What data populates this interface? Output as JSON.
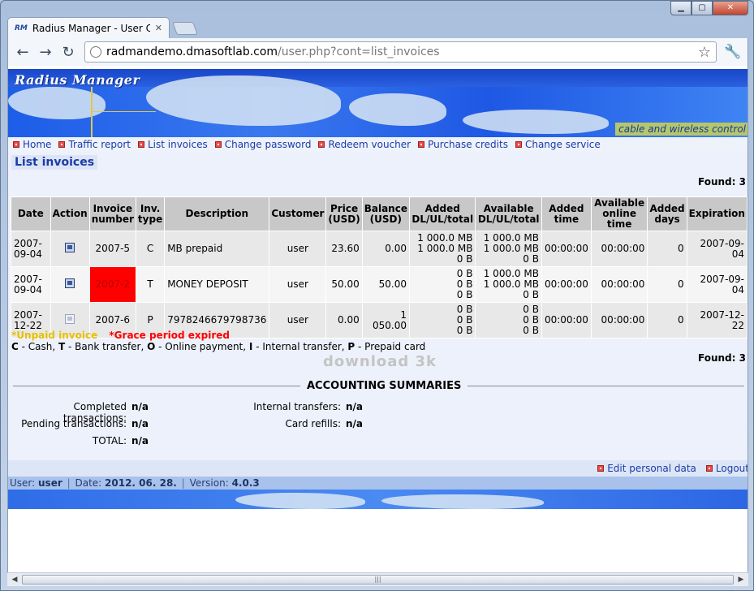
{
  "browser": {
    "tab_title": "Radius Manager - User Con",
    "tab_favicon": "RM",
    "url_host": "radmandemo.dmasoftlab.com",
    "url_path": "/user.php?cont=list_invoices",
    "close_glyph": "✕",
    "min_glyph": "▁",
    "max_glyph": "▢",
    "back_glyph": "←",
    "forward_glyph": "→",
    "reload_glyph": "↻",
    "star_glyph": "☆",
    "wrench_glyph": "🔧"
  },
  "banner": {
    "title": "Radius Manager",
    "tagline": "cable and wireless control"
  },
  "menu": [
    {
      "label": "Home"
    },
    {
      "label": "Traffic report"
    },
    {
      "label": "List invoices"
    },
    {
      "label": "Change password"
    },
    {
      "label": "Redeem voucher"
    },
    {
      "label": "Purchase credits"
    },
    {
      "label": "Change service"
    }
  ],
  "page": {
    "title": "List invoices",
    "found_label": "Found:",
    "found_count": "3"
  },
  "table": {
    "headers": [
      "Date",
      "Action",
      "Invoice number",
      "Inv. type",
      "Description",
      "Customer",
      "Price (USD)",
      "Balance (USD)",
      "Added DL/UL/total",
      "Available DL/UL/total",
      "Added time",
      "Available online time",
      "Added days",
      "Expiration"
    ],
    "rows": [
      {
        "date": "2007-09-04",
        "invoice": "2007-5",
        "type": "C",
        "description": "MB prepaid",
        "customer": "user",
        "price": "23.60",
        "balance": "0.00",
        "added": [
          "1 000.0 MB",
          "1 000.0 MB",
          "0 B"
        ],
        "available": [
          "1 000.0 MB",
          "1 000.0 MB",
          "0 B"
        ],
        "added_time": "00:00:00",
        "available_time": "00:00:00",
        "added_days": "0",
        "expiration": "2007-09-04"
      },
      {
        "date": "2007-09-04",
        "invoice": "2007-2",
        "type": "T",
        "description": "MONEY DEPOSIT",
        "customer": "user",
        "price": "50.00",
        "balance": "50.00",
        "added": [
          "0 B",
          "0 B",
          "0 B"
        ],
        "available": [
          "1 000.0 MB",
          "1 000.0 MB",
          "0 B"
        ],
        "added_time": "00:00:00",
        "available_time": "00:00:00",
        "added_days": "0",
        "expiration": "2007-09-04"
      },
      {
        "date": "2007-12-22",
        "invoice": "2007-6",
        "type": "P",
        "description": "7978246679798736",
        "customer": "user",
        "price": "0.00",
        "balance": "1 050.00",
        "added": [
          "0 B",
          "0 B",
          "0 B"
        ],
        "available": [
          "0 B",
          "0 B",
          "0 B"
        ],
        "added_time": "00:00:00",
        "available_time": "00:00:00",
        "added_days": "0",
        "expiration": "2007-12-22"
      }
    ]
  },
  "watermark": "download 3k",
  "legend": {
    "unpaid": "*Unpaid invoice",
    "grace": "*Grace period expired",
    "types": [
      {
        "code": "C",
        "text": " - Cash, "
      },
      {
        "code": "T",
        "text": " - Bank transfer, "
      },
      {
        "code": "O",
        "text": " - Online payment, "
      },
      {
        "code": "I",
        "text": " - Internal transfer, "
      },
      {
        "code": "P",
        "text": " - Prepaid card"
      }
    ]
  },
  "summary": {
    "title": "ACCOUNTING SUMMARIES",
    "completed_label": "Completed transactions:",
    "completed_value": "n/a",
    "pending_label": "Pending transactions:",
    "pending_value": "n/a",
    "total_label": "TOTAL:",
    "total_value": "n/a",
    "internal_label": "Internal transfers:",
    "internal_value": "n/a",
    "refills_label": "Card refills:",
    "refills_value": "n/a"
  },
  "footer": {
    "edit_label": "Edit personal data",
    "logout_label": "Logout"
  },
  "status": {
    "user_label": "User:",
    "user_value": "user",
    "date_label": "Date:",
    "date_value": "2012. 06. 28.",
    "version_label": "Version:",
    "version_value": "4.0.3",
    "sep": "|"
  },
  "colors": {
    "unpaid": "#e8c000",
    "grace": "#ff0000",
    "link": "#1a3ca8"
  }
}
